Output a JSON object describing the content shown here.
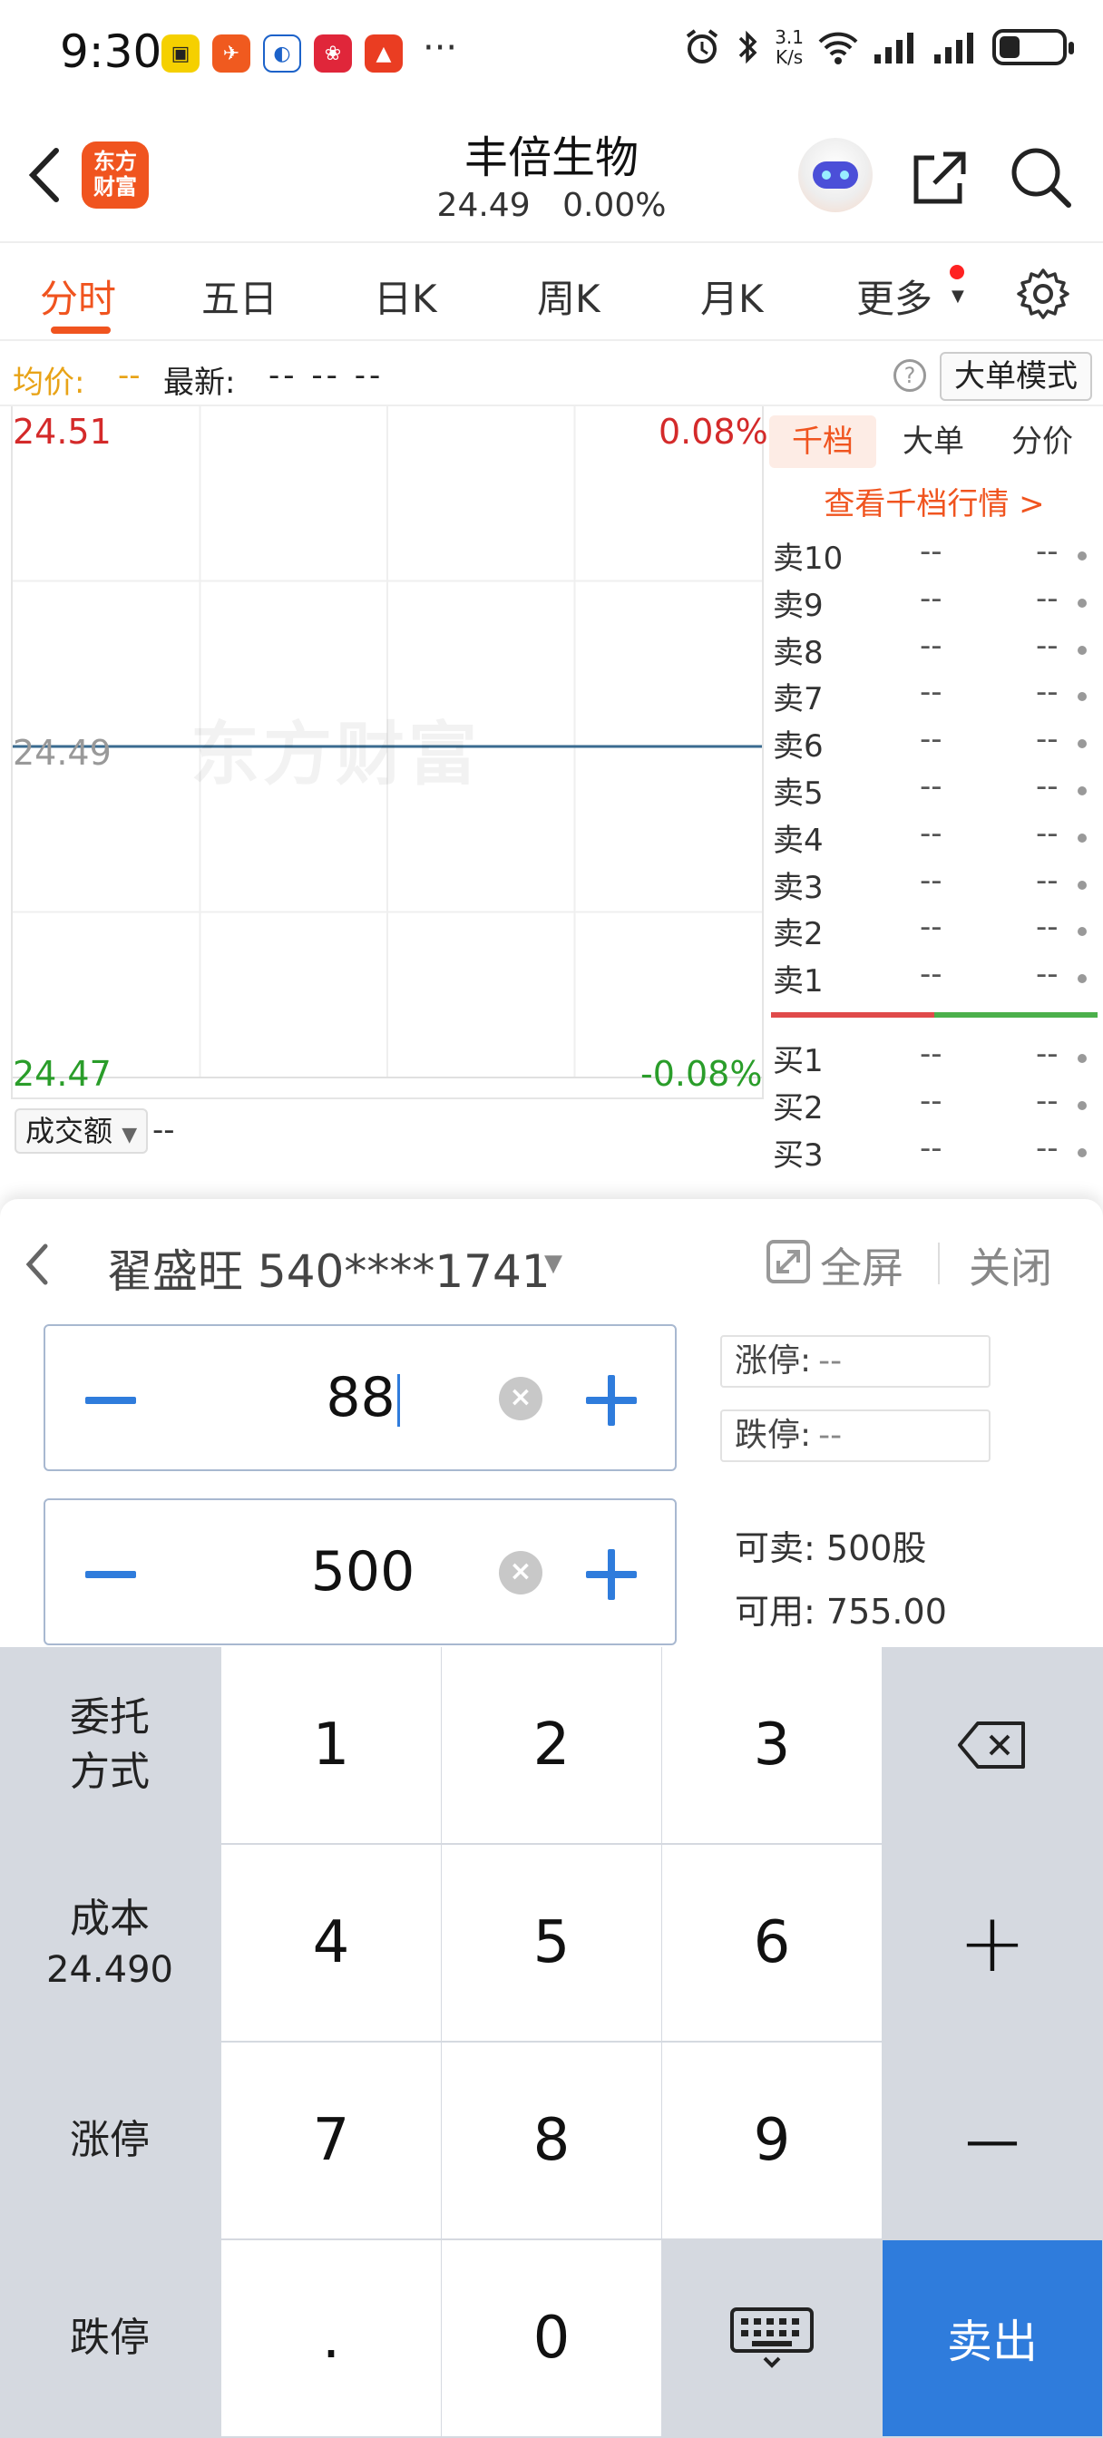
{
  "status_bar": {
    "time": "9:30",
    "net_speed_top": "3.1",
    "net_speed_bottom": "K/s",
    "more": "···"
  },
  "header": {
    "logo_line1": "东方",
    "logo_line2": "财富",
    "stock_name": "丰倍生物",
    "price": "24.49",
    "change_pct": "0.00%"
  },
  "tabs": [
    "分时",
    "五日",
    "日K",
    "周K",
    "月K",
    "更多"
  ],
  "info_row": {
    "avg_label": "均价:",
    "avg_value": "--",
    "latest_label": "最新:",
    "latest_values": "-- -- --",
    "mode_button": "大单模式"
  },
  "chart": {
    "price_high": "24.51",
    "pct_high": "0.08%",
    "price_mid": "24.49",
    "price_low": "24.47",
    "pct_low": "-0.08%",
    "watermark": "东方财富",
    "volume_select": "成交额",
    "volume_value": "--"
  },
  "chart_data": {
    "type": "line",
    "ylim": [
      24.47,
      24.51
    ],
    "series": [
      {
        "values": [
          24.49,
          24.49
        ]
      }
    ],
    "y_tick_labels": [
      "24.51",
      "24.49",
      "24.47"
    ],
    "right_tick_labels": [
      "0.08%",
      "-0.08%"
    ]
  },
  "order_book": {
    "tabs": [
      "千档",
      "大单",
      "分价"
    ],
    "link": "查看千档行情 >",
    "sell": [
      {
        "level": "卖10",
        "price": "--",
        "vol": "--"
      },
      {
        "level": "卖9",
        "price": "--",
        "vol": "--"
      },
      {
        "level": "卖8",
        "price": "--",
        "vol": "--"
      },
      {
        "level": "卖7",
        "price": "--",
        "vol": "--"
      },
      {
        "level": "卖6",
        "price": "--",
        "vol": "--"
      },
      {
        "level": "卖5",
        "price": "--",
        "vol": "--"
      },
      {
        "level": "卖4",
        "price": "--",
        "vol": "--"
      },
      {
        "level": "卖3",
        "price": "--",
        "vol": "--"
      },
      {
        "level": "卖2",
        "price": "--",
        "vol": "--"
      },
      {
        "level": "卖1",
        "price": "--",
        "vol": "--"
      }
    ],
    "buy": [
      {
        "level": "买1",
        "price": "--",
        "vol": "--"
      },
      {
        "level": "买2",
        "price": "--",
        "vol": "--"
      },
      {
        "level": "买3",
        "price": "--",
        "vol": "--"
      }
    ]
  },
  "trade_panel": {
    "account": "翟盛旺 540****1741",
    "fullscreen": "全屏",
    "close": "关闭",
    "price_input": "88",
    "qty_input": "500",
    "limit_up_label": "涨停:",
    "limit_up_value": "--",
    "limit_down_label": "跌停:",
    "limit_down_value": "--",
    "sellable_label": "可卖:",
    "sellable_value": "500股",
    "available_label": "可用:",
    "available_value": "755.00"
  },
  "keypad": {
    "order_type_line1": "委托",
    "order_type_line2": "方式",
    "cost_label": "成本",
    "cost_value": "24.490",
    "limit_up": "涨停",
    "limit_down": "跌停",
    "digits": [
      "1",
      "2",
      "3",
      "4",
      "5",
      "6",
      "7",
      "8",
      "9",
      ".",
      "0"
    ],
    "plus": "+",
    "minus": "—",
    "sell": "卖出"
  },
  "colors": {
    "accent": "#f0541f",
    "up": "#d42a2a",
    "down": "#2a9d2a",
    "primary": "#2f7cdc"
  }
}
